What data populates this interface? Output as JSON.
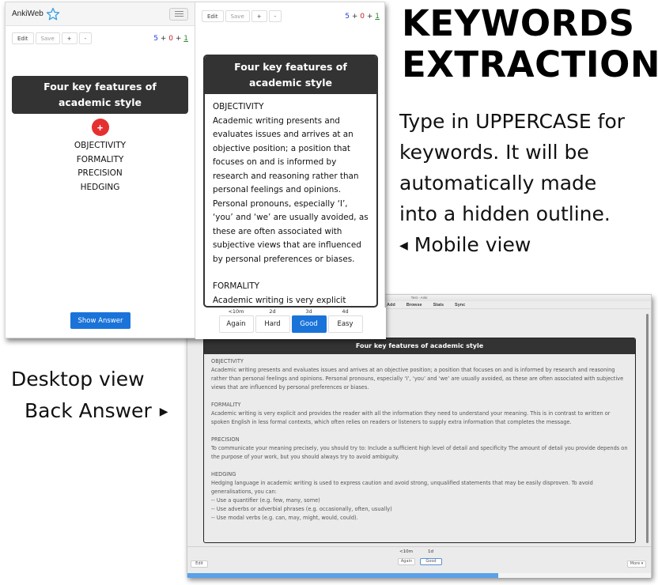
{
  "annotation": {
    "headline_line1": "KEYWORDS",
    "headline_line2": "EXTRACTION",
    "description_lines": [
      "Type in UPPERCASE for",
      "keywords. It will be",
      "automatically made",
      "into a hidden outline."
    ],
    "mobile_pointer": "Mobile view",
    "desktop_label_line1": "Desktop view",
    "desktop_label_line2": "Back Answer"
  },
  "mobile": {
    "brand": "AnkiWeb",
    "toolbar": {
      "edit": "Edit",
      "save": "Save",
      "plus": "+",
      "minus": "-"
    },
    "counts": {
      "new": "5",
      "learn": "0",
      "review": "1",
      "sep": "+"
    },
    "back_counts": {
      "new": "5",
      "learn": "0",
      "review": "1",
      "sep": "+"
    },
    "front": {
      "title": "Four key features of academic style",
      "reveal_icon": "+",
      "keywords": [
        "OBJECTIVITY",
        "FORMALITY",
        "PRECISION",
        "HEDGING"
      ],
      "show_answer": "Show Answer"
    },
    "back": {
      "title": "Four key features of academic style",
      "sections": [
        {
          "heading": "OBJECTIVITY",
          "text": "Academic writing presents and evaluates issues and arrives at an objective position; a position that focuses on and is informed by research and reasoning rather than personal feelings and opinions. Personal pronouns, especially ‘I’, ‘you’ and ‘we’ are usually avoided, as these are often associated with subjective views that are influenced by personal preferences or biases."
        },
        {
          "heading": "FORMALITY",
          "text": "Academic writing is very explicit"
        }
      ],
      "ease": [
        {
          "interval": "<10m",
          "label": "Again"
        },
        {
          "interval": "2d",
          "label": "Hard"
        },
        {
          "interval": "3d",
          "label": "Good"
        },
        {
          "interval": "4d",
          "label": "Easy"
        }
      ]
    }
  },
  "desktop": {
    "window_title": "Test - Anki",
    "menu": [
      "Add",
      "Browse",
      "Stats",
      "Sync"
    ],
    "card_title": "Four key features of academic style",
    "sections": [
      {
        "heading": "OBJECTIVITY",
        "lines": [
          "Academic writing presents and evaluates issues and arrives at an objective position; a position that focuses on and is informed by research and reasoning rather than personal feelings and opinions. Personal pronouns, especially ‘I’, ‘you’ and ‘we’ are usually avoided, as these are often associated with subjective views that are influenced by personal preferences or biases."
        ]
      },
      {
        "heading": "FORMALITY",
        "lines": [
          "Academic writing is very explicit and provides the reader with all the information they need to understand your meaning. This is in contrast to written or spoken English in less formal contexts, which often relies on readers or listeners to supply extra information that completes the message."
        ]
      },
      {
        "heading": "PRECISION",
        "lines": [
          "To communicate your meaning precisely, you should try to: Include a sufficient high level of detail and specificity The amount of detail you provide depends on the purpose of your work, but you should always try to avoid ambiguity."
        ]
      },
      {
        "heading": "HEDGING",
        "lines": [
          "Hedging language in academic writing is used to express caution and avoid strong, unqualified statements that may be easily disproven. To avoid generalisations, you can:",
          "-- Use a quantifier (e.g. few, many, some)",
          "-- Use adverbs or adverbial phrases (e.g. occasionally, often, usually)",
          "-- Use modal verbs (e.g. can, may, might, would, could)."
        ]
      }
    ],
    "edit": "Edit",
    "more": "More ▾",
    "ease": [
      {
        "interval": "<10m",
        "label": "Again"
      },
      {
        "interval": "1d",
        "label": "Good"
      }
    ],
    "progress_fraction": 0.67
  },
  "colors": {
    "accent_blue": "#1a73d9",
    "reveal_red": "#e53030",
    "count_new": "#1f3fd6",
    "count_learn": "#c62020",
    "count_review": "#2a8a2a"
  }
}
